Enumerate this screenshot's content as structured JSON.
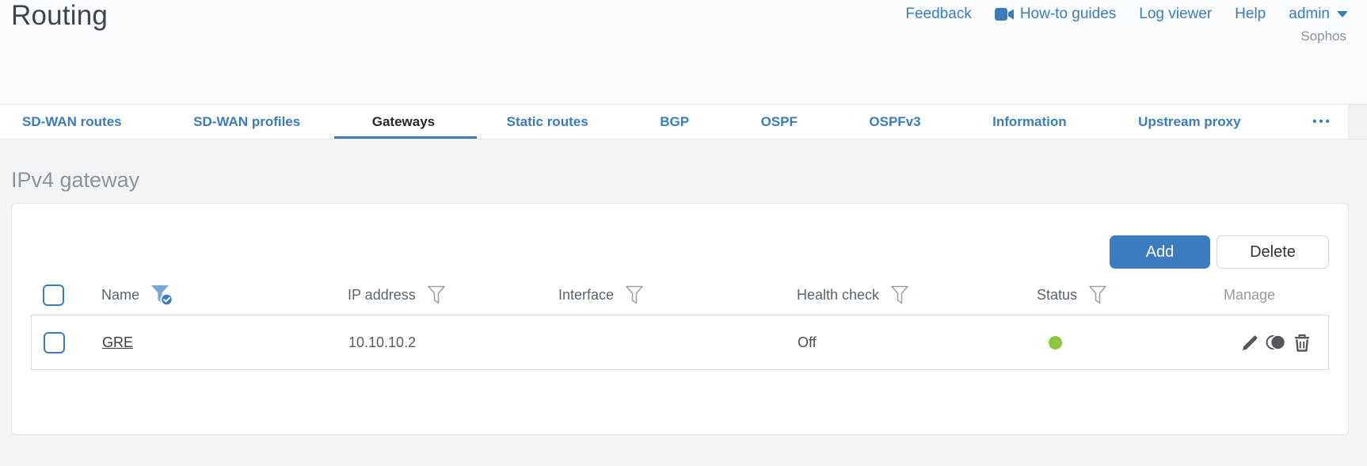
{
  "page": {
    "title": "Routing"
  },
  "top_nav": {
    "feedback": "Feedback",
    "how_to_guides": "How-to guides",
    "log_viewer": "Log viewer",
    "help": "Help",
    "user": "admin",
    "brand": "Sophos"
  },
  "tabs": [
    {
      "label": "SD-WAN routes",
      "active": false
    },
    {
      "label": "SD-WAN profiles",
      "active": false
    },
    {
      "label": "Gateways",
      "active": true
    },
    {
      "label": "Static routes",
      "active": false
    },
    {
      "label": "BGP",
      "active": false
    },
    {
      "label": "OSPF",
      "active": false
    },
    {
      "label": "OSPFv3",
      "active": false
    },
    {
      "label": "Information",
      "active": false
    },
    {
      "label": "Upstream proxy",
      "active": false
    },
    {
      "label": "•••",
      "active": false
    }
  ],
  "section": {
    "heading": "IPv4 gateway"
  },
  "toolbar": {
    "add_label": "Add",
    "delete_label": "Delete"
  },
  "table": {
    "columns": [
      {
        "label": "Name",
        "filter": "active"
      },
      {
        "label": "IP address",
        "filter": "default"
      },
      {
        "label": "Interface",
        "filter": "default"
      },
      {
        "label": "Health check",
        "filter": "default"
      },
      {
        "label": "Status",
        "filter": "default"
      },
      {
        "label": "Manage",
        "filter": "none"
      }
    ],
    "rows": [
      {
        "name": "GRE",
        "ip_address": "10.10.10.2",
        "interface": "",
        "health_check": "Off",
        "status": "up",
        "status_dot_style": "background-color:#8cc63f"
      }
    ]
  },
  "colors": {
    "accent_blue": "#3a7cbd",
    "status_green": "#8cc63f",
    "active_tab_text": "#26292e",
    "heading_gray": "#8d949b",
    "border_gray": "#e3e5e8",
    "icon_gray": "#54585e"
  }
}
